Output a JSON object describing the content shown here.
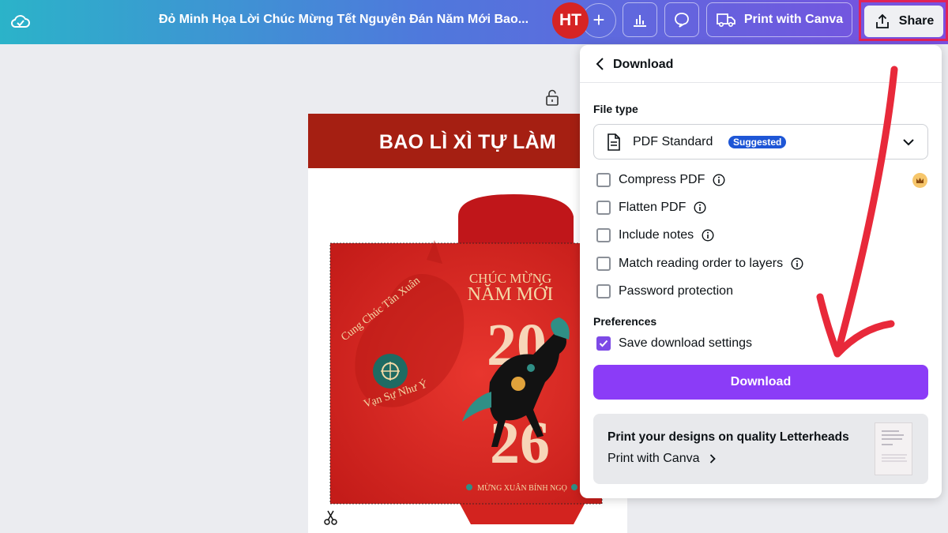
{
  "topbar": {
    "document_title": "Đỏ Minh Họa Lời Chúc Mừng Tết Nguyên Đán Năm Mới Bao...",
    "avatar_initials": "HT",
    "print_label": "Print with Canva",
    "share_label": "Share"
  },
  "design": {
    "header_text": "BAO LÌ XÌ TỰ LÀM",
    "greeting_line1": "CHÚC MỪNG",
    "greeting_line2": "NĂM MỚI",
    "year_top": "20",
    "year_bottom": "26",
    "arc_text_top": "Cung Chúc Tân Xuân",
    "arc_text_bottom": "Vạn Sự Như Ý",
    "footer_text": "MỪNG XUÂN BÍNH NGỌ"
  },
  "download_panel": {
    "title": "Download",
    "file_type_label": "File type",
    "file_type_value": "PDF Standard",
    "suggested_badge": "Suggested",
    "options": [
      {
        "label": "Compress PDF",
        "checked": false
      },
      {
        "label": "Flatten PDF",
        "checked": false
      },
      {
        "label": "Include notes",
        "checked": false
      },
      {
        "label": "Match reading order to layers",
        "checked": false
      },
      {
        "label": "Password protection",
        "checked": false
      }
    ],
    "preferences_label": "Preferences",
    "save_settings_label": "Save download settings",
    "save_settings_checked": true,
    "download_button": "Download",
    "promo_title": "Print your designs on quality Letterheads",
    "promo_link": "Print with Canva"
  },
  "colors": {
    "accent_purple": "#8b3cf7",
    "header_red": "#a51f12",
    "annotation_red": "#e02357",
    "badge_blue": "#1e56d6"
  }
}
